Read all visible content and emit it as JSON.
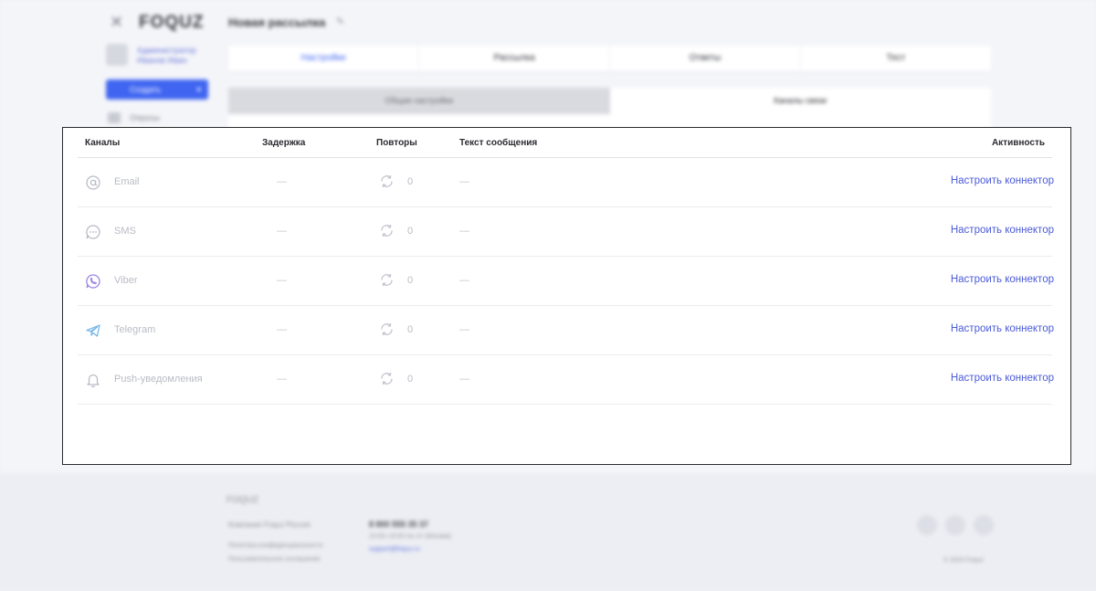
{
  "app": {
    "logo": "FOQUZ",
    "page_title": "Новая рассылка",
    "user": {
      "line1": "Администратор",
      "line2": "Иванов Иван"
    },
    "create_button": "Создать",
    "nav_item": "Опросы"
  },
  "tabs": [
    {
      "label": "Настройки",
      "active": true
    },
    {
      "label": "Рассылка",
      "active": false
    },
    {
      "label": "Ответы",
      "active": false
    },
    {
      "label": "Тест",
      "active": false
    }
  ],
  "subtabs": [
    {
      "label": "Общие настройки",
      "active": false
    },
    {
      "label": "Каналы связи",
      "active": true
    }
  ],
  "table": {
    "headers": {
      "channels": "Каналы",
      "delay": "Задержка",
      "repeats": "Повторы",
      "message": "Текст сообщения",
      "activity": "Активность"
    },
    "rows": [
      {
        "icon": "at-sign-icon",
        "name": "Email",
        "delay": "—",
        "repeats": "0",
        "message": "—",
        "action": "Настроить коннектор"
      },
      {
        "icon": "chat-bubble-icon",
        "name": "SMS",
        "delay": "—",
        "repeats": "0",
        "message": "—",
        "action": "Настроить коннектор"
      },
      {
        "icon": "viber-icon",
        "name": "Viber",
        "delay": "—",
        "repeats": "0",
        "message": "—",
        "action": "Настроить коннектор"
      },
      {
        "icon": "telegram-icon",
        "name": "Telegram",
        "delay": "—",
        "repeats": "0",
        "message": "—",
        "action": "Настроить коннектор"
      },
      {
        "icon": "bell-icon",
        "name": "Push-уведомления",
        "delay": "—",
        "repeats": "0",
        "message": "—",
        "action": "Настроить коннектор"
      }
    ]
  },
  "footer": {
    "logo": "FOQUZ",
    "line1": "Компания Foquz Россия",
    "line2": "Политика конфиденциальности",
    "line3": "Пользовательское соглашение",
    "phone": "8 800 555 35 37",
    "hours": "10:00–19:00 пн–пт (Москва)",
    "email": "support@foquz.ru",
    "copyright": "© 2024 Foquz"
  },
  "colors": {
    "accent": "#3f65f1",
    "link": "#4a5bd8",
    "telegram": "#5aa9e6",
    "viber": "#7d5ee0"
  }
}
